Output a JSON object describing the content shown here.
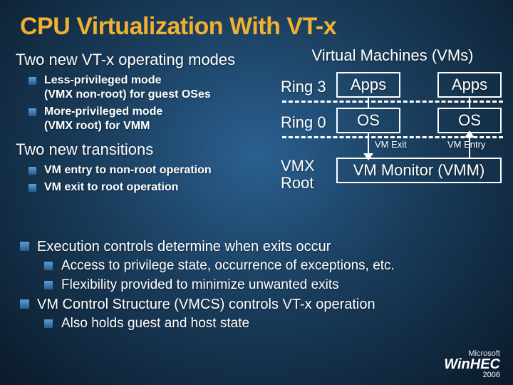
{
  "title": "CPU Virtualization With VT-x",
  "left": {
    "heading1": "Two new VT-x operating modes",
    "sub1_a_l1": "Less-privileged mode",
    "sub1_a_l2": "(VMX non-root) for guest OSes",
    "sub1_b_l1": "More-privileged mode",
    "sub1_b_l2": "(VMX root) for VMM",
    "heading2": "Two new transitions",
    "sub2_a": "VM entry to non-root operation",
    "sub2_b": "VM exit to root operation"
  },
  "diagram": {
    "vm_title": "Virtual Machines (VMs)",
    "ring3": "Ring 3",
    "ring0": "Ring 0",
    "apps": "Apps",
    "os": "OS",
    "vm_exit": "VM Exit",
    "vm_entry": "VM Entry",
    "vmx_root_l1": "VMX",
    "vmx_root_l2": "Root",
    "vmm": "VM Monitor (VMM)"
  },
  "bottom": {
    "l1": "Execution controls determine when exits occur",
    "l1a": "Access to privilege state, occurrence of exceptions, etc.",
    "l1b": "Flexibility provided to minimize unwanted exits",
    "l2": "VM Control Structure (VMCS) controls VT-x operation",
    "l2a": "Also holds guest and host state"
  },
  "footer": {
    "ms": "Microsoft",
    "brand": "WinHEC",
    "year": "2006"
  }
}
